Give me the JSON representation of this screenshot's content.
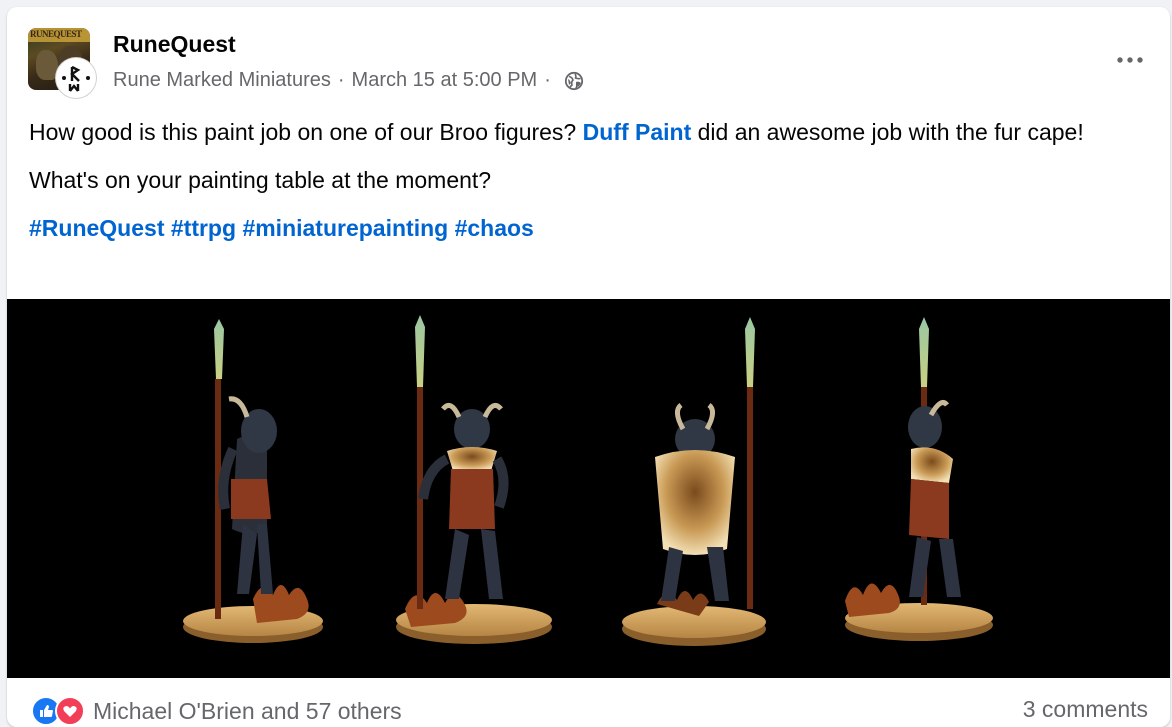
{
  "post": {
    "page_name": "RuneQuest",
    "author": "Rune Marked Miniatures",
    "separator": "·",
    "timestamp": "March 15 at 5:00 PM",
    "privacy_icon": "globe-icon",
    "more_icon": "more-options-icon",
    "avatar_banner": "RUNEQUEST",
    "avatar_sub_monogram": "ᚱ",
    "text_part1": "How good is this paint job on one of our Broo figures? ",
    "mention": "Duff Paint",
    "text_part2": " did an awesome job with the fur cape!",
    "question": "What's on your painting table at the moment?",
    "hashtags": [
      "#RuneQuest",
      "#ttrpg",
      "#miniaturepainting",
      "#chaos"
    ]
  },
  "footer": {
    "reactions_text": "Michael O'Brien and 57 others",
    "comments_text": "3 comments",
    "reaction_icons": [
      "like-icon",
      "love-icon"
    ]
  },
  "colors": {
    "link": "#0064d1",
    "secondary_text": "#65676b",
    "primary_text": "#050505",
    "like": "#1877f2",
    "love": "#f33e58"
  }
}
